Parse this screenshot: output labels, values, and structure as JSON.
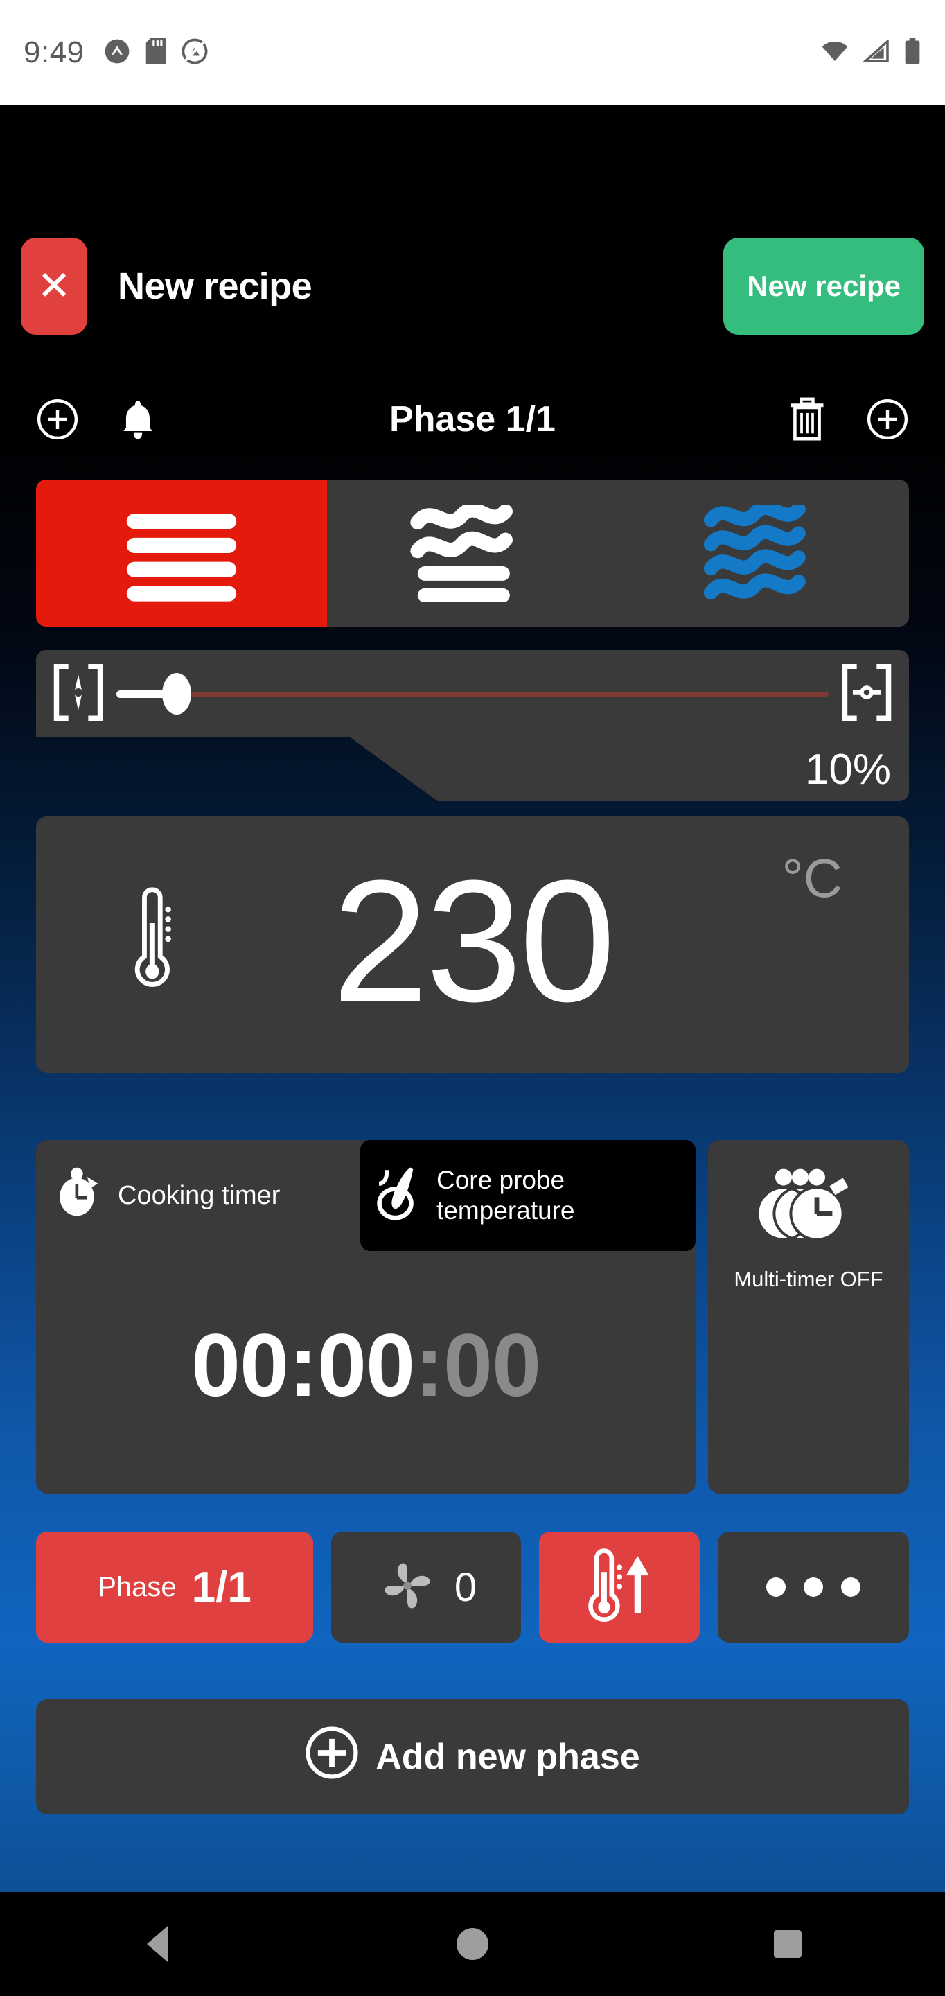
{
  "status_bar": {
    "time": "9:49",
    "left_icons": [
      "app-notification-icon",
      "sd-card-icon",
      "do-not-disturb-icon"
    ],
    "right_icons": [
      "wifi-icon",
      "cellular-signal-icon",
      "battery-icon"
    ]
  },
  "header": {
    "close_label": "✕",
    "title": "New recipe",
    "action_label": "New recipe"
  },
  "phase_bar": {
    "add_left_icon": "plus-circle-icon",
    "bell_icon": "bell-icon",
    "title": "Phase 1/1",
    "delete_icon": "trash-icon",
    "add_right_icon": "plus-circle-icon"
  },
  "mode_selector": {
    "modes": [
      {
        "name": "dry-heat",
        "selected": true
      },
      {
        "name": "combi-heat",
        "selected": false
      },
      {
        "name": "steam",
        "selected": false
      }
    ],
    "selected_color": "#e41a0d",
    "steam_color": "#1479c7"
  },
  "humidity": {
    "left_icon": "vent-closed-icon",
    "right_icon": "vent-open-icon",
    "value": 10,
    "value_label": "10%",
    "track_color": "#7c3a33"
  },
  "temperature": {
    "icon": "thermometer-icon",
    "value": "230",
    "unit": "°C"
  },
  "timer": {
    "tabs": [
      {
        "label": "Cooking timer",
        "icon": "cooking-timer-icon",
        "selected": true
      },
      {
        "label": "Core probe\ntemperature",
        "label_line1": "Core probe",
        "label_line2": "temperature",
        "icon": "core-probe-icon",
        "selected": false
      }
    ],
    "time_main": "00:00",
    "time_seconds": ":00"
  },
  "multi_timer": {
    "icon": "multi-timer-icon",
    "label": "Multi-timer OFF"
  },
  "actions": [
    {
      "name": "phase-indicator",
      "label": "Phase",
      "value": "1/1",
      "color": "#e04040"
    },
    {
      "name": "fan-speed",
      "icon": "fan-icon",
      "value": "0",
      "color": "#3a3a3a"
    },
    {
      "name": "preheat",
      "icon": "preheat-thermometer-icon",
      "value": "",
      "color": "#e04040"
    },
    {
      "name": "more-options",
      "icon": "ellipsis-icon",
      "value": "",
      "color": "#3a3a3a"
    }
  ],
  "add_phase": {
    "icon": "plus-circle-icon",
    "label": "Add new phase"
  },
  "nav_bar": {
    "back": "back-icon",
    "home": "home-icon",
    "recents": "recents-icon"
  }
}
